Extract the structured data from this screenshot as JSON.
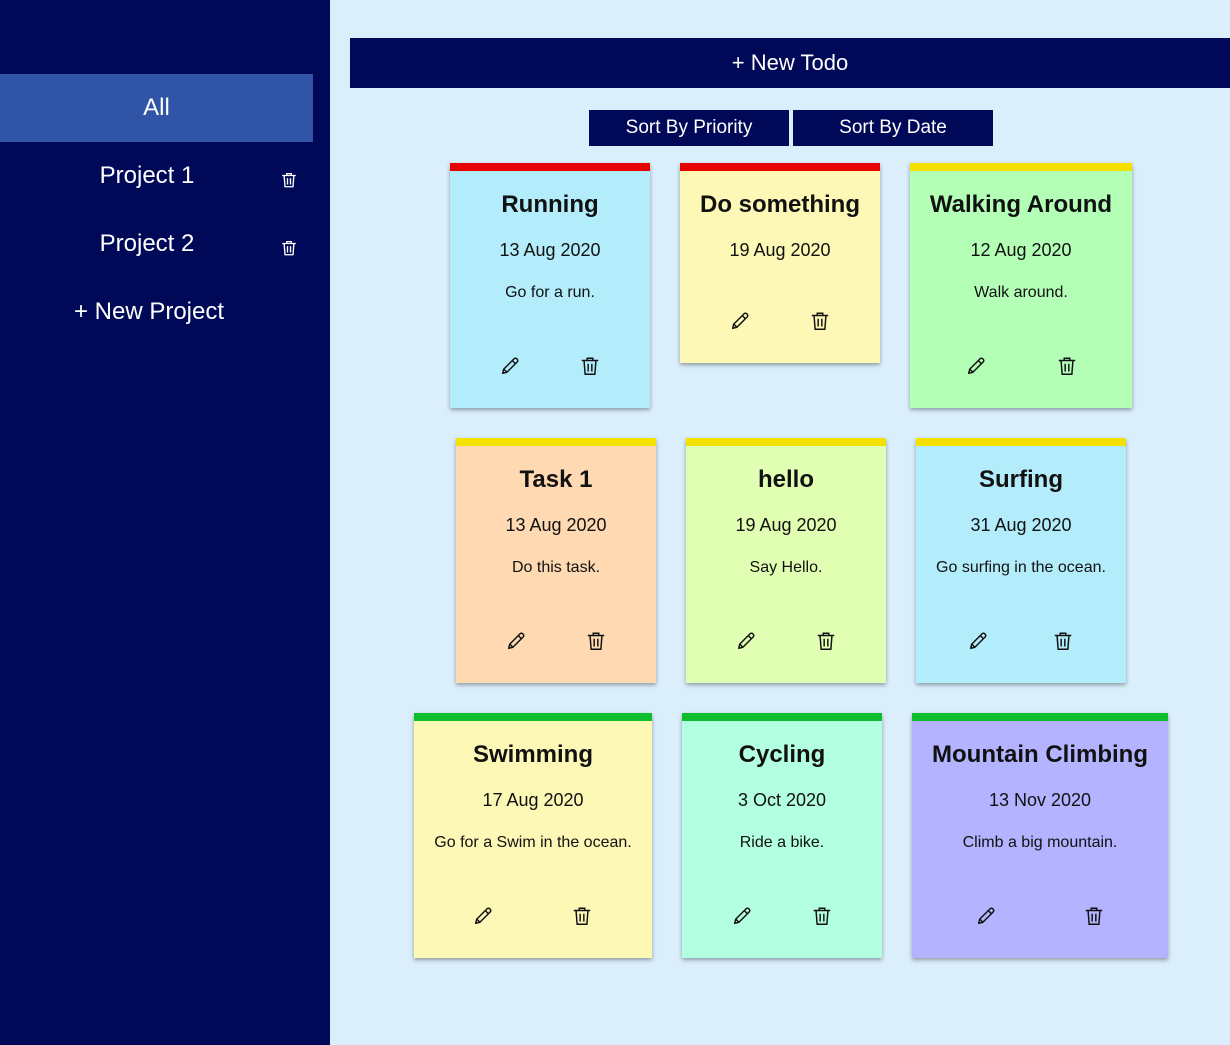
{
  "sidebar": {
    "all_label": "All",
    "projects": [
      {
        "label": "Project 1"
      },
      {
        "label": "Project 2"
      }
    ],
    "new_project_label": "+ New Project"
  },
  "toolbar": {
    "new_todo_label": "+ New Todo",
    "sort_priority_label": "Sort By Priority",
    "sort_date_label": "Sort By Date"
  },
  "priority_colors": {
    "high": "#e60000",
    "medium": "#f5e100",
    "low": "#0cbe2c"
  },
  "todos": [
    {
      "title": "Running",
      "date": "13 Aug 2020",
      "description": "Go for a run.",
      "priority": "high",
      "color": "#b3ecfb"
    },
    {
      "title": "Do something",
      "date": "19 Aug 2020",
      "description": "",
      "priority": "high",
      "color": "#fdf8b5"
    },
    {
      "title": "Walking Around",
      "date": "12 Aug 2020",
      "description": "Walk around.",
      "priority": "medium",
      "color": "#b3ffb5"
    },
    {
      "title": "Task 1",
      "date": "13 Aug 2020",
      "description": "Do this task.",
      "priority": "medium",
      "color": "#fed9b1"
    },
    {
      "title": "hello",
      "date": "19 Aug 2020",
      "description": "Say Hello.",
      "priority": "medium",
      "color": "#e1ffb2"
    },
    {
      "title": "Surfing",
      "date": "31 Aug 2020",
      "description": "Go surfing in the ocean.",
      "priority": "medium",
      "color": "#b3ecfb"
    },
    {
      "title": "Swimming",
      "date": "17 Aug 2020",
      "description": "Go for a Swim in the ocean.",
      "priority": "low",
      "color": "#fdf8b5"
    },
    {
      "title": "Cycling",
      "date": "3 Oct 2020",
      "description": "Ride a bike.",
      "priority": "low",
      "color": "#b3ffe1"
    },
    {
      "title": "Mountain Climbing",
      "date": "13 Nov 2020",
      "description": "Climb a big mountain.",
      "priority": "low",
      "color": "#b3b3ff"
    }
  ]
}
